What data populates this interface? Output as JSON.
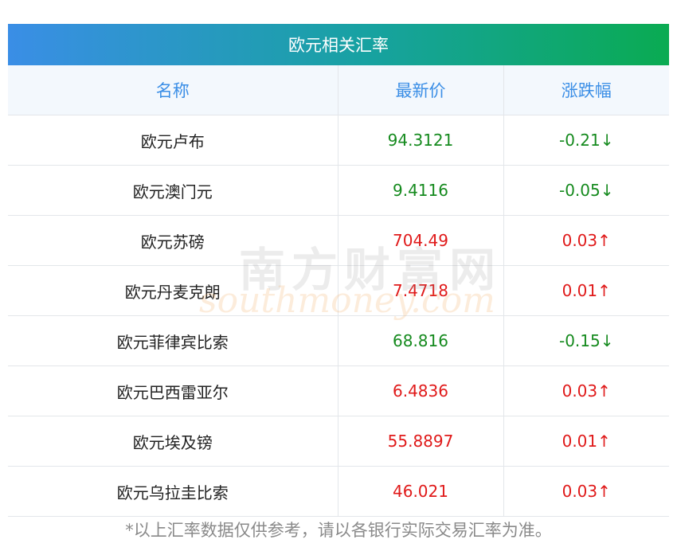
{
  "title": "欧元相关汇率",
  "headers": {
    "name": "名称",
    "price": "最新价",
    "change": "涨跌幅"
  },
  "rows": [
    {
      "name": "欧元卢布",
      "price": "94.3121",
      "change": "-0.21↓",
      "dir": "down"
    },
    {
      "name": "欧元澳门元",
      "price": "9.4116",
      "change": "-0.05↓",
      "dir": "down"
    },
    {
      "name": "欧元苏磅",
      "price": "704.49",
      "change": "0.03↑",
      "dir": "up"
    },
    {
      "name": "欧元丹麦克朗",
      "price": "7.4718",
      "change": "0.01↑",
      "dir": "up"
    },
    {
      "name": "欧元菲律宾比索",
      "price": "68.816",
      "change": "-0.15↓",
      "dir": "down"
    },
    {
      "name": "欧元巴西雷亚尔",
      "price": "6.4836",
      "change": "0.03↑",
      "dir": "up"
    },
    {
      "name": "欧元埃及镑",
      "price": "55.8897",
      "change": "0.01↑",
      "dir": "up"
    },
    {
      "name": "欧元乌拉圭比索",
      "price": "46.021",
      "change": "0.03↑",
      "dir": "up"
    }
  ],
  "note": "*以上汇率数据仅供参考，请以各银行实际交易汇率为准。",
  "watermark": {
    "cn": "南方财富网",
    "en": "southmoney.com"
  },
  "colors": {
    "up": "#e01a1a",
    "down": "#158a1e",
    "header_text": "#3a8ee6"
  }
}
